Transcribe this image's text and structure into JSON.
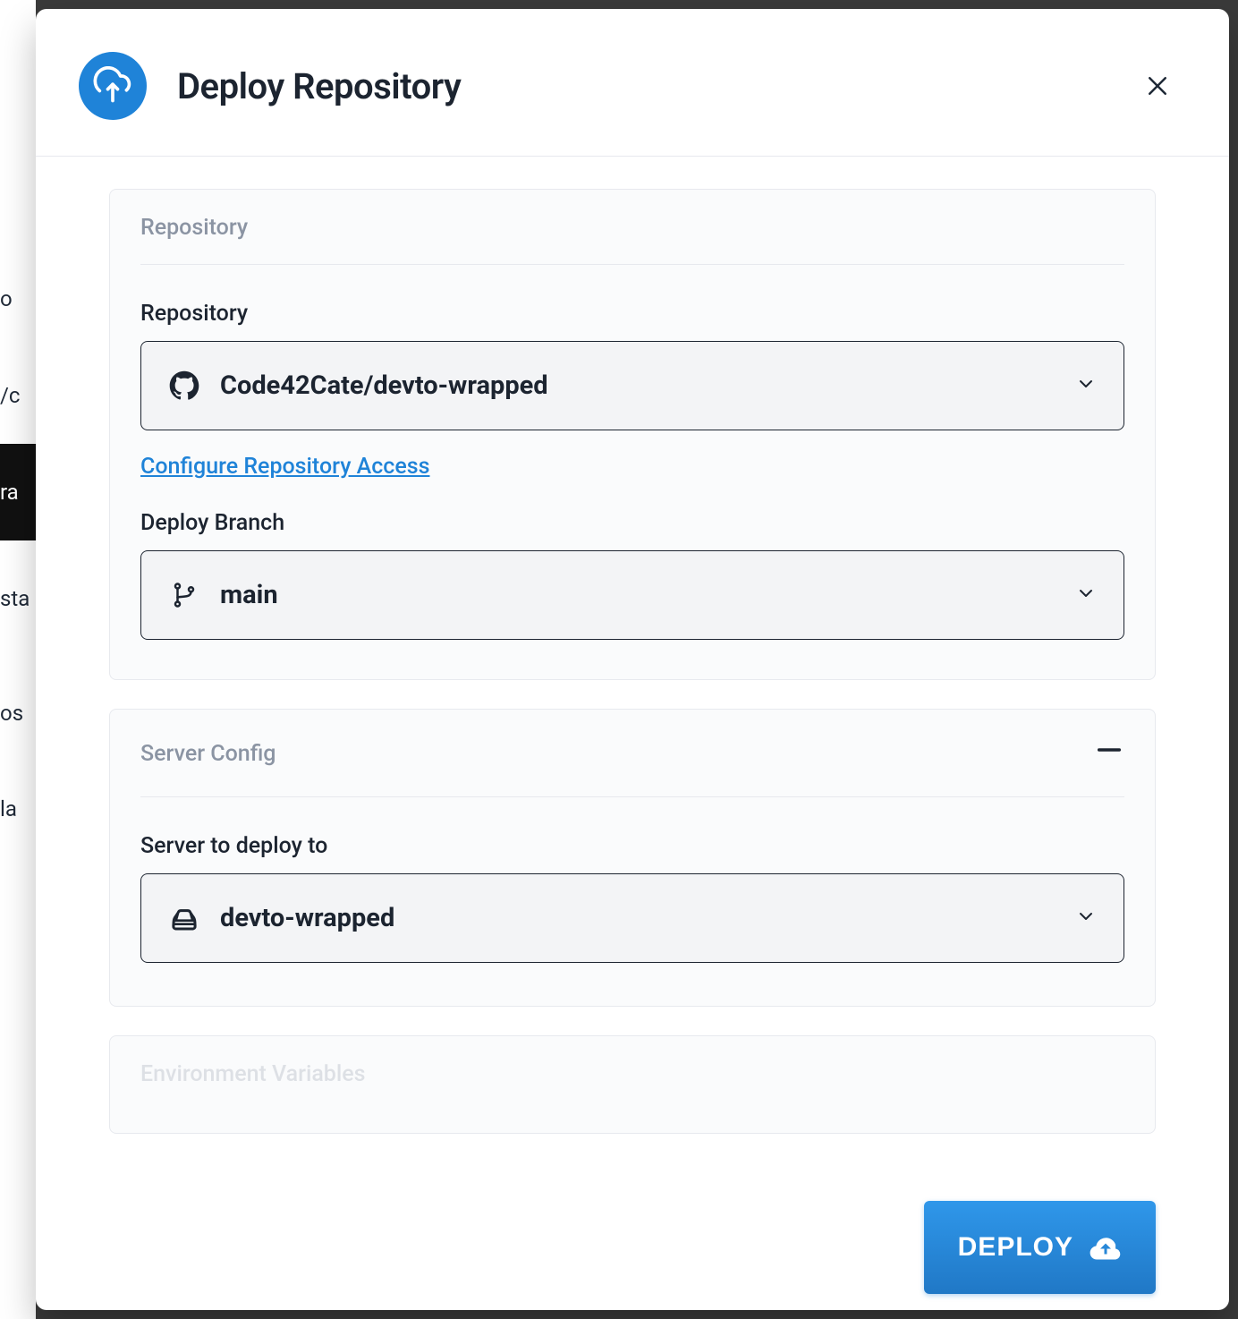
{
  "modal": {
    "title": "Deploy Repository",
    "close_label": "Close"
  },
  "repo_section": {
    "heading": "Repository",
    "repo_field_label": "Repository",
    "repo_selected": "Code42Cate/devto-wrapped",
    "configure_access_link": "Configure Repository Access",
    "branch_field_label": "Deploy Branch",
    "branch_selected": "main"
  },
  "server_section": {
    "heading": "Server Config",
    "server_field_label": "Server to deploy to",
    "server_selected": "devto-wrapped"
  },
  "env_section": {
    "heading": "Environment Variables"
  },
  "deploy_button": "DEPLOY",
  "bg_left": {
    "line1": "o",
    "line2": "/c",
    "line3": "ra",
    "line4": "sta",
    "line5": "os",
    "line6": "la"
  },
  "colors": {
    "accent": "#1f83d8",
    "text": "#1c2430",
    "muted": "#8b94a3",
    "card_bg": "#fafbfc",
    "border": "#e7e9ee"
  }
}
